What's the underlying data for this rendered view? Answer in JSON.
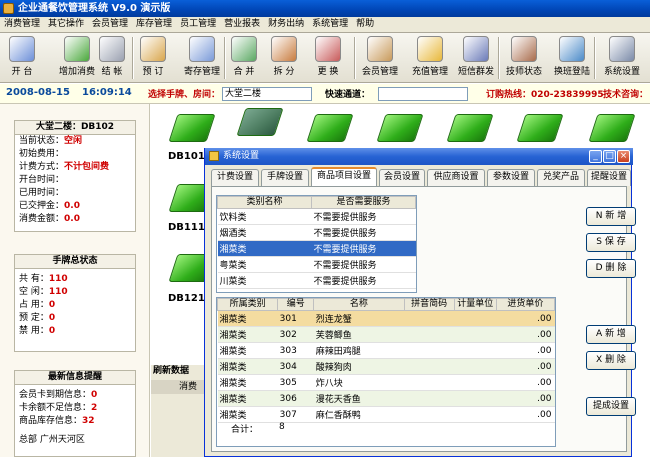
{
  "app": {
    "title": "企业通餐饮管理系统 V9.0  演示版"
  },
  "menu": [
    "消费管理",
    "其它操作",
    "会员管理",
    "库存管理",
    "员工管理",
    "营业报表",
    "财务出纳",
    "系统管理",
    "帮助"
  ],
  "toolbar": [
    {
      "label": "开 台",
      "icon": "open-table-icon",
      "color": "#6c8fd8"
    },
    {
      "label": "增加消费",
      "icon": "add-consumption-icon",
      "color": "#4aa83c"
    },
    {
      "label": "结 帐",
      "icon": "checkout-icon",
      "color": "#9aa0b0"
    },
    {
      "label": "预 订",
      "icon": "reserve-icon",
      "color": "#d9a64c"
    },
    {
      "label": "寄存管理",
      "icon": "storage-icon",
      "color": "#7a9ad8"
    },
    {
      "label": "合 并",
      "icon": "merge-icon",
      "color": "#5aa862"
    },
    {
      "label": "拆 分",
      "icon": "split-icon",
      "color": "#c87b3e"
    },
    {
      "label": "更 换",
      "icon": "swap-icon",
      "color": "#c85a5a"
    },
    {
      "label": "会员管理",
      "icon": "member-icon",
      "color": "#c89a5a"
    },
    {
      "label": "充值管理",
      "icon": "recharge-icon",
      "color": "#e8b83a"
    },
    {
      "label": "短信群发",
      "icon": "sms-icon",
      "color": "#6a7ab8"
    },
    {
      "label": "技师状态",
      "icon": "technician-icon",
      "color": "#a86a4a"
    },
    {
      "label": "换班登陆",
      "icon": "shift-login-icon",
      "color": "#4a8ac8"
    },
    {
      "label": "系统设置",
      "icon": "settings-icon",
      "color": "#7a8aa8"
    }
  ],
  "status": {
    "date": "2008-08-15",
    "time": "16:09:14",
    "select_label": "选择手牌、房间：",
    "select_value": "大堂二楼",
    "quick_label": "快速通道：",
    "quick_value": "",
    "hotline": "订购热线：020-23839995",
    "support": "技术咨询："
  },
  "room": {
    "title": "大堂二楼：DB102",
    "rows": [
      {
        "label": "当前状态：",
        "value": "空闲"
      },
      {
        "label": "初始费用：",
        "value": ""
      },
      {
        "label": "计费方式：",
        "value": "不计包间费"
      },
      {
        "label": "开台时间：",
        "value": ""
      },
      {
        "label": "已用时间：",
        "value": ""
      },
      {
        "label": "已交押金：",
        "value": "0.0"
      },
      {
        "label": "消费金额：",
        "value": "0.0"
      }
    ]
  },
  "summary": {
    "title": "手牌总状态",
    "rows": [
      {
        "label": "共      有：",
        "value": "110"
      },
      {
        "label": "空      闲：",
        "value": "110"
      },
      {
        "label": "占      用：",
        "value": "0"
      },
      {
        "label": "预      定：",
        "value": "0"
      },
      {
        "label": "禁      用：",
        "value": "0"
      }
    ]
  },
  "alerts": {
    "title": "最新信息提醒",
    "rows": [
      {
        "label": "会员卡到期信息：",
        "value": "0"
      },
      {
        "label": "卡余额不足信息：",
        "value": "2"
      },
      {
        "label": "商品库存信息：",
        "value": "32"
      }
    ],
    "footer": "总部  广州天河区"
  },
  "tables": {
    "labels": [
      "DB101",
      "DB111",
      "DB121"
    ]
  },
  "lower": {
    "tab": "刷新数据",
    "header": "消费"
  },
  "dialog": {
    "title": "系统设置",
    "tabs": [
      "计费设置",
      "手牌设置",
      "商品项目设置",
      "会员设置",
      "供应商设置",
      "参数设置",
      "兑奖产品",
      "提醒设置"
    ],
    "active_tab": 2,
    "category_headers": [
      "类别名称",
      "是否需要服务"
    ],
    "categories": [
      {
        "name": "饮料类",
        "service": "不需要提供服务"
      },
      {
        "name": "烟酒类",
        "service": "不需要提供服务"
      },
      {
        "name": "湘菜类",
        "service": "不需要提供服务"
      },
      {
        "name": "粤菜类",
        "service": "不需要提供服务"
      },
      {
        "name": "川菜类",
        "service": "不需要提供服务"
      }
    ],
    "item_headers": [
      "所属类别",
      "编号",
      "名称",
      "拼音简码",
      "计量单位",
      "进货单价"
    ],
    "items": [
      {
        "cat": "湘菜类",
        "no": "301",
        "name": "烈连龙蟹",
        "py": "",
        "unit": "",
        "price": ".00"
      },
      {
        "cat": "湘菜类",
        "no": "302",
        "name": "芙蓉鲫鱼",
        "py": "",
        "unit": "",
        "price": ".00"
      },
      {
        "cat": "湘菜类",
        "no": "303",
        "name": "麻辣田鸡腿",
        "py": "",
        "unit": "",
        "price": ".00"
      },
      {
        "cat": "湘菜类",
        "no": "304",
        "name": "酸辣狗肉",
        "py": "",
        "unit": "",
        "price": ".00"
      },
      {
        "cat": "湘菜类",
        "no": "305",
        "name": "炸八块",
        "py": "",
        "unit": "",
        "price": ".00"
      },
      {
        "cat": "湘菜类",
        "no": "306",
        "name": "漫花天香鱼",
        "py": "",
        "unit": "",
        "price": ".00"
      },
      {
        "cat": "湘菜类",
        "no": "307",
        "name": "麻仁香酥鸭",
        "py": "",
        "unit": "",
        "price": ".00"
      }
    ],
    "total_label": "合计：",
    "total_value": "8",
    "buttons": {
      "new_cat": "N 新 增",
      "save_cat": "S 保 存",
      "del_cat": "D 删 除",
      "add_item": "A 新 增",
      "del_item": "X 删 除",
      "extract": "提成设置"
    }
  }
}
